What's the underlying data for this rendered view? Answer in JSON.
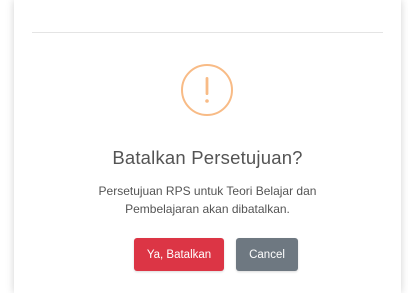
{
  "dialog": {
    "icon": "warning-exclamation-icon",
    "icon_glyph": "!",
    "icon_color": "#f8bb86",
    "title": "Batalkan Persetujuan?",
    "message_line1": "Persetujuan RPS untuk Teori Belajar dan",
    "message_line2": "Pembelajaran akan dibatalkan.",
    "confirm_label": "Ya, Batalkan",
    "cancel_label": "Cancel",
    "confirm_color": "#dc3545",
    "cancel_color": "#6e7881"
  }
}
